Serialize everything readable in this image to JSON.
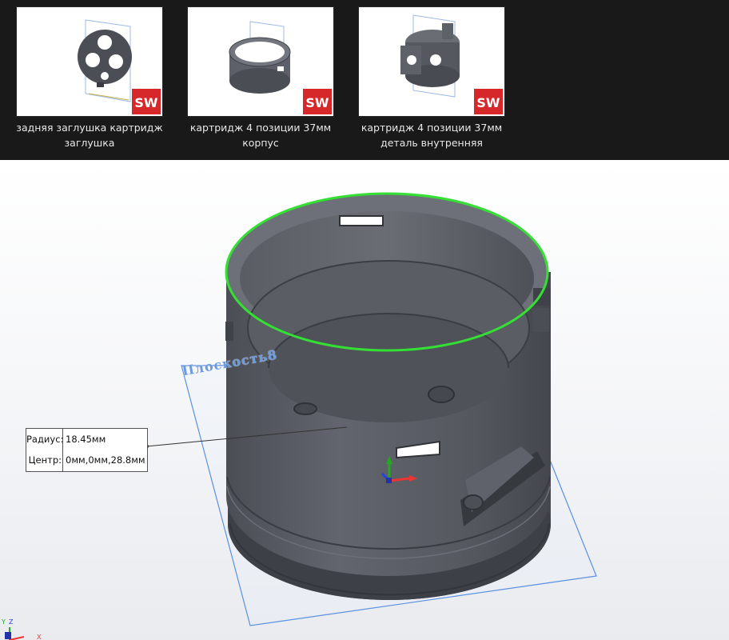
{
  "files": [
    {
      "line1": "задняя заглушка картридж",
      "line2": "заглушка"
    },
    {
      "line1": "картридж 4 позиции 37мм",
      "line2": "корпус"
    },
    {
      "line1": "картридж 4 позиции 37мм",
      "line2": "деталь внутренняя"
    }
  ],
  "badge_text": "SW",
  "viewport": {
    "plane_label": "Плоскость8",
    "measure": {
      "radius_label": "Радиус:",
      "radius_value": "18.45мм",
      "center_label": "Центр:",
      "center_value": "0мм,0мм,28.8мм"
    },
    "triad": {
      "x": "X",
      "y": "Y",
      "z": "Z"
    }
  },
  "colors": {
    "explorer_bg": "#191919",
    "model_gray": "#5c5f66",
    "selected_edge": "#33e033",
    "plane_blue": "#6b9ae0",
    "badge_red": "#d6272a"
  }
}
